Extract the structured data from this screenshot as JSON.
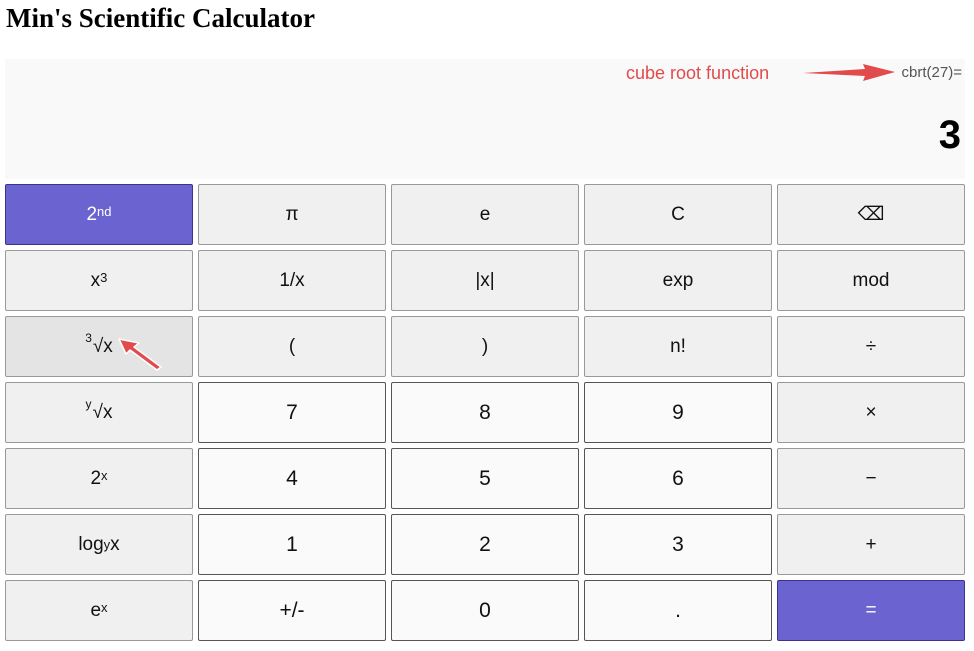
{
  "app": {
    "title": "Min's Scientific Calculator"
  },
  "display": {
    "expression": "cbrt(27)=",
    "result": "3"
  },
  "annotations": {
    "top_label": "cube root function",
    "color": "#e24b4b"
  },
  "colors": {
    "accent": "#6b63cf",
    "function_key": "#f0f0f0",
    "number_key": "#fafafa",
    "display_bg": "#f9f9f9"
  },
  "keys": {
    "second": {
      "base": "2",
      "sup": "nd"
    },
    "pi": "π",
    "e": "e",
    "clear": "C",
    "backspace": "⌫",
    "cube": {
      "base": "x",
      "sup": "3"
    },
    "reciprocal": "1/x",
    "abs": "|x|",
    "exp": "exp",
    "mod": "mod",
    "cube_root": {
      "index": "3",
      "base": "√x"
    },
    "paren_open": "(",
    "paren_close": ")",
    "factorial": "n!",
    "divide": "÷",
    "y_root": {
      "index": "y",
      "base": "√x"
    },
    "seven": "7",
    "eight": "8",
    "nine": "9",
    "multiply": "×",
    "two_pow": {
      "base": "2",
      "sup": "x"
    },
    "four": "4",
    "five": "5",
    "six": "6",
    "minus": "−",
    "log_y": {
      "base": "log",
      "sub": "y",
      "tail": "x"
    },
    "one": "1",
    "two": "2",
    "three": "3",
    "plus": "+",
    "e_pow": {
      "base": "e",
      "sup": "x"
    },
    "negate": "+/-",
    "zero": "0",
    "decimal": ".",
    "equals": "="
  }
}
